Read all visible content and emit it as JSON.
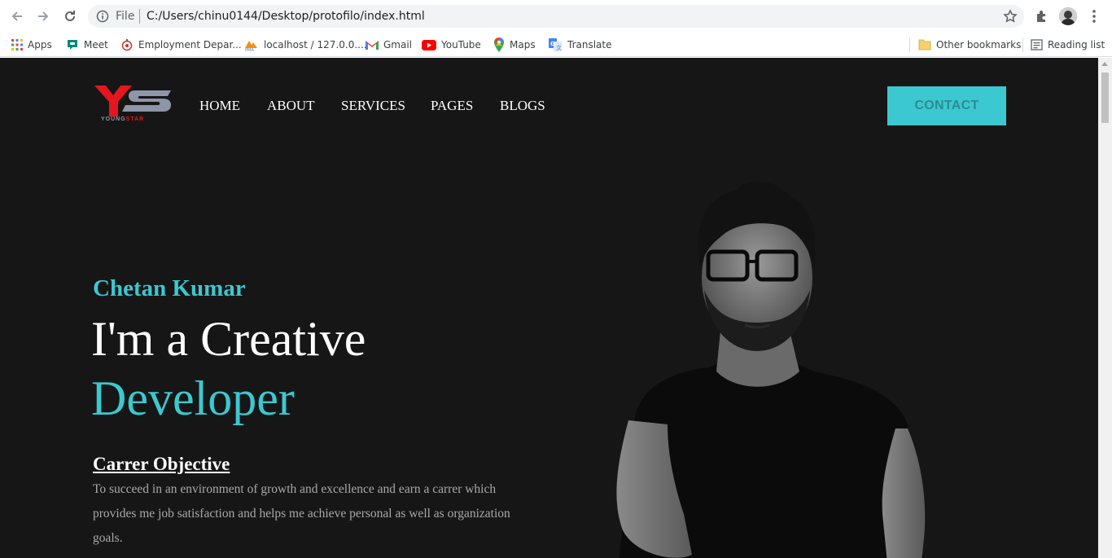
{
  "browser": {
    "address": {
      "scheme_label": "File",
      "url": "C:/Users/chinu0144/Desktop/protofilo/index.html"
    },
    "bookmarks": [
      {
        "label": "Apps",
        "icon": "apps-grid-icon"
      },
      {
        "label": "Meet",
        "icon": "meet-icon"
      },
      {
        "label": "Employment Depar...",
        "icon": "employment-icon"
      },
      {
        "label": "localhost / 127.0.0....",
        "icon": "phpmyadmin-icon"
      },
      {
        "label": "Gmail",
        "icon": "gmail-icon"
      },
      {
        "label": "YouTube",
        "icon": "youtube-icon"
      },
      {
        "label": "Maps",
        "icon": "maps-icon"
      },
      {
        "label": "Translate",
        "icon": "translate-icon"
      }
    ],
    "other_bookmarks": "Other bookmarks",
    "reading_list": "Reading list"
  },
  "site": {
    "logo_text": "YOUNGSTAR",
    "nav": [
      "HOME",
      "ABOUT",
      "SERVICES",
      "PAGES",
      "BLOGS"
    ],
    "contact_label": "CONTACT",
    "hero": {
      "name": "Chetan Kumar",
      "line1": "I'm a Creative",
      "line2": "Developer"
    },
    "objective": {
      "title": "Carrer Objective",
      "text": "To succeed in an environment of growth and excellence and earn a carrer which provides me job satisfaction and helps me achieve personal as well as organization goals."
    }
  },
  "colors": {
    "page_bg": "#161616",
    "accent": "#3cc8d0",
    "logo_red": "#e5161f",
    "logo_steel": "#8e95a8"
  }
}
